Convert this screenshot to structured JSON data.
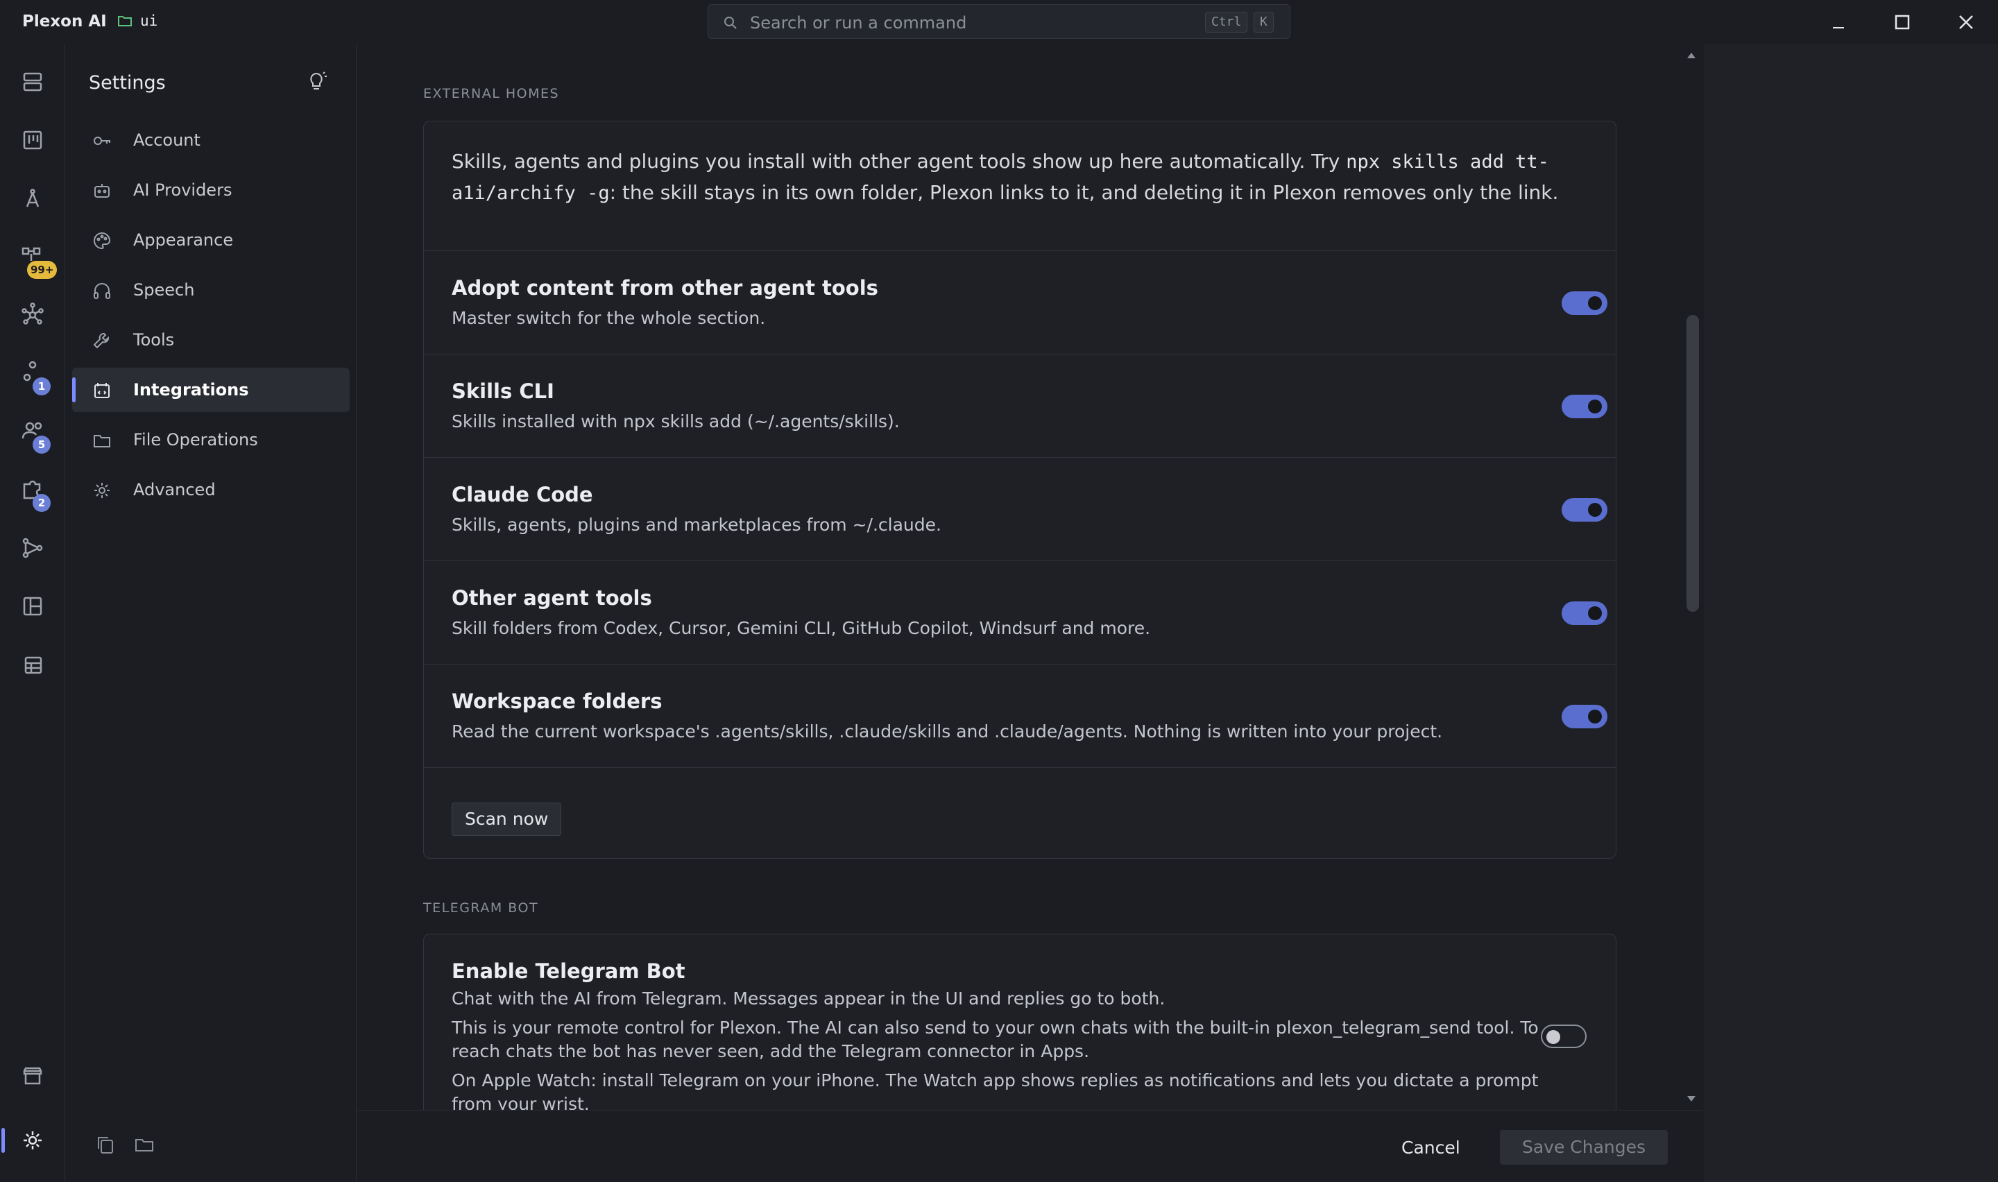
{
  "titlebar": {
    "app_name": "Plexon AI",
    "folder": "ui",
    "search_placeholder": "Search or run a command",
    "shortcut_ctrl": "Ctrl",
    "shortcut_k": "K"
  },
  "rail": {
    "badges": {
      "item4": "99+",
      "item6": "1",
      "item7": "5",
      "item8": "2"
    },
    "active": "settings",
    "accent": "#7b8cff"
  },
  "settings": {
    "title": "Settings",
    "items": [
      {
        "label": "Account",
        "icon": "key-icon"
      },
      {
        "label": "AI Providers",
        "icon": "robot-icon"
      },
      {
        "label": "Appearance",
        "icon": "palette-icon"
      },
      {
        "label": "Speech",
        "icon": "headphones-icon"
      },
      {
        "label": "Tools",
        "icon": "wrench-icon"
      },
      {
        "label": "Integrations",
        "icon": "integrations-icon",
        "active": true
      },
      {
        "label": "File Operations",
        "icon": "folder-icon"
      },
      {
        "label": "Advanced",
        "icon": "gear-icon"
      }
    ]
  },
  "external_homes": {
    "section_label": "EXTERNAL HOMES",
    "intro_before": "Skills, agents and plugins you install with other agent tools show up here automatically. Try ",
    "intro_code": "npx skills add tt-a1i/archify -g",
    "intro_after": ": the skill stays in its own folder, Plexon links to it, and deleting it in Plexon removes only the link.",
    "rows": [
      {
        "title": "Adopt content from other agent tools",
        "desc": "Master switch for the whole section.",
        "enabled": true
      },
      {
        "title": "Skills CLI",
        "desc": "Skills installed with npx skills add (~/.agents/skills).",
        "enabled": true
      },
      {
        "title": "Claude Code",
        "desc": "Skills, agents, plugins and marketplaces from ~/.claude.",
        "enabled": true
      },
      {
        "title": "Other agent tools",
        "desc": "Skill folders from Codex, Cursor, Gemini CLI, GitHub Copilot, Windsurf and more.",
        "enabled": true
      },
      {
        "title": "Workspace folders",
        "desc": "Read the current workspace's .agents/skills, .claude/skills and .claude/agents. Nothing is written into your project.",
        "enabled": true
      }
    ],
    "scan_label": "Scan now"
  },
  "telegram": {
    "section_label": "TELEGRAM BOT",
    "title": "Enable Telegram Bot",
    "p1": "Chat with the AI from Telegram. Messages appear in the UI and replies go to both.",
    "p2": "This is your remote control for Plexon. The AI can also send to your own chats with the built-in plexon_telegram_send tool. To reach chats the bot has never seen, add the Telegram connector in Apps.",
    "p3": "On Apple Watch: install Telegram on your iPhone. The Watch app shows replies as notifications and lets you dictate a prompt from your wrist.",
    "enabled": false
  },
  "footer": {
    "cancel": "Cancel",
    "save": "Save Changes"
  },
  "colors": {
    "toggle_on": "#5a6ed0",
    "background": "#1b1d22"
  }
}
